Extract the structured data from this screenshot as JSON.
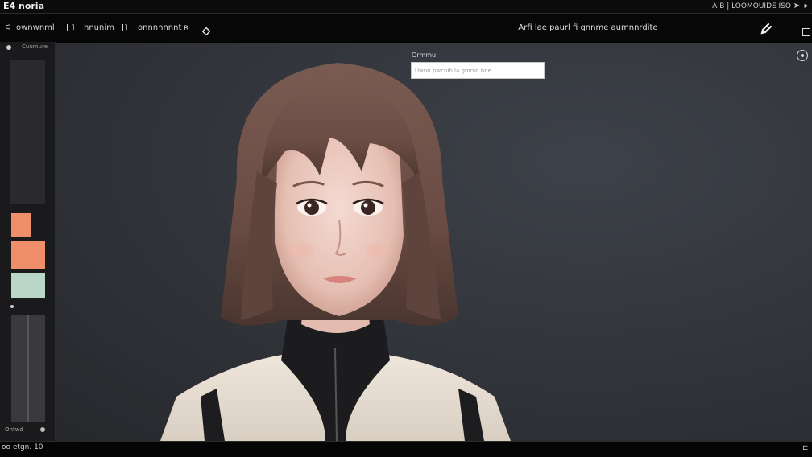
{
  "window": {
    "app_name": "E4 noria",
    "right_text": "A  B | LOOMOUIDE ISO",
    "arrow1": "➤",
    "arrow2": "▸"
  },
  "toolbar": {
    "items": [
      {
        "icon": "⚟",
        "label": "ownwnml"
      },
      {
        "icon": "ǀ ˥",
        "label": "hnunim"
      },
      {
        "icon": "ǀ˥",
        "label": "onnnnnnnt"
      },
      {
        "icon": "ʀ",
        "label": ""
      }
    ],
    "diamond_icon": "diamond-icon",
    "status_text": "Arfi lae paurl  fi  gnnme aumnnrdite",
    "edit_icon": "edit-icon",
    "window_icon": "maximize-icon"
  },
  "sidebar": {
    "header": "Cuumure",
    "swatches": [
      {
        "color": "#ee8f6a"
      },
      {
        "color": "#ee8f6a"
      },
      {
        "color": "#b9d6c6"
      }
    ],
    "footer_label": "Ontwd"
  },
  "search": {
    "label": "Ormmu",
    "placeholder": "Uwnn pwcnib la gmnin bne..."
  },
  "statusbar": {
    "text": "oo etgn. 10",
    "right_icon": "⊏"
  },
  "colors": {
    "canvas_bg": "#33363c",
    "swatch_orange": "#ee8f6a",
    "swatch_mint": "#b9d6c6"
  }
}
